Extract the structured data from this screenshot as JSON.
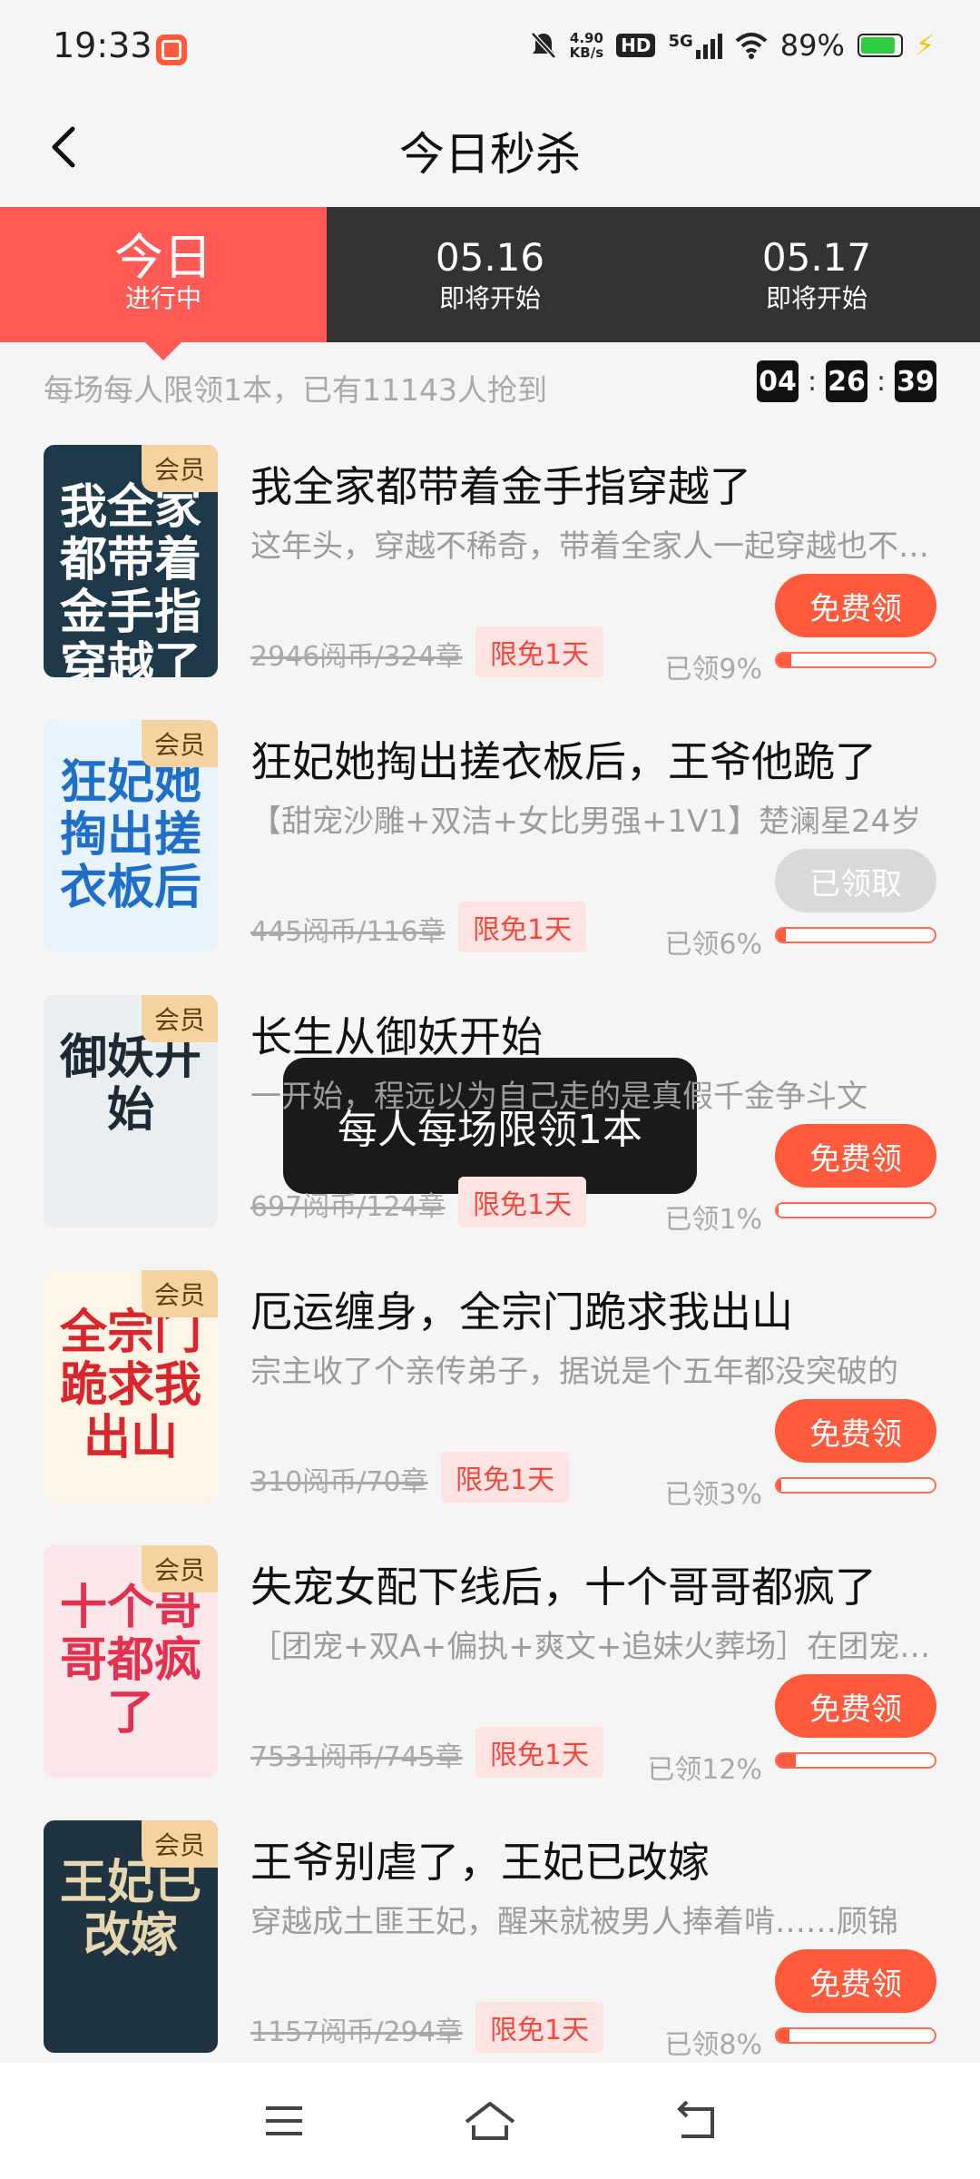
{
  "status_bar": {
    "time": "19:33",
    "net_speed_value": "4.90",
    "net_speed_unit": "KB/s",
    "hd_label": "HD",
    "network": "5G",
    "battery_percent": "89%",
    "battery_level": 0.89
  },
  "header": {
    "title": "今日秒杀",
    "back_icon": "chevron-left-icon"
  },
  "tabs": [
    {
      "top": "今日",
      "bottom": "进行中",
      "active": true
    },
    {
      "top": "05.16",
      "bottom": "即将开始",
      "active": false
    },
    {
      "top": "05.17",
      "bottom": "即将开始",
      "active": false
    }
  ],
  "info": {
    "text": "每场每人限领1本，已有11143人抢到",
    "countdown": {
      "hours": "04",
      "minutes": "26",
      "seconds": "39",
      "separator": ":"
    }
  },
  "vip_label": "会员",
  "books": [
    {
      "title": "我全家都带着金手指穿越了",
      "desc": "这年头，穿越不稀奇，带着全家人一起穿越也不稀奇",
      "price": "2946阅币/324章",
      "free_tag": "限免1天",
      "button": "免费领",
      "claimed": false,
      "claimed_text": "已领9%",
      "progress": 0.09,
      "cover_text": "我全家都带着金手指穿越了",
      "cover_bg": "#1e3a4a",
      "cover_fg": "#ffffff"
    },
    {
      "title": "狂妃她掏出搓衣板后，王爷他跪了",
      "desc": "【甜宠沙雕+双洁+女比男强+1V1】楚澜星24岁",
      "price": "445阅币/116章",
      "free_tag": "限免1天",
      "button": "已领取",
      "claimed": true,
      "claimed_text": "已领6%",
      "progress": 0.06,
      "cover_text": "狂妃她掏出搓衣板后",
      "cover_bg": "#e8f3fb",
      "cover_fg": "#1f6fc9"
    },
    {
      "title": "长生从御妖开始",
      "desc": "一开始，程远以为自己走的是真假千金争斗文",
      "price": "697阅币/124章",
      "free_tag": "限免1天",
      "button": "免费领",
      "claimed": false,
      "claimed_text": "已领1%",
      "progress": 0.01,
      "cover_text": "御妖开始",
      "cover_bg": "#e9eef0",
      "cover_fg": "#1d2a33"
    },
    {
      "title": "厄运缠身，全宗门跪求我出山",
      "desc": "宗主收了个亲传弟子，据说是个五年都没突破的",
      "price": "310阅币/70章",
      "free_tag": "限免1天",
      "button": "免费领",
      "claimed": false,
      "claimed_text": "已领3%",
      "progress": 0.03,
      "cover_text": "全宗门跪求我出山",
      "cover_bg": "#fdf6e6",
      "cover_fg": "#d8262c"
    },
    {
      "title": "失宠女配下线后，十个哥哥都疯了",
      "desc": "［团宠+双A+偏执+爽文+追妹火葬场］在团宠文里",
      "price": "7531阅币/745章",
      "free_tag": "限免1天",
      "button": "免费领",
      "claimed": false,
      "claimed_text": "已领12%",
      "progress": 0.12,
      "cover_text": "十个哥哥都疯了",
      "cover_bg": "#fbe6ea",
      "cover_fg": "#e2314f"
    },
    {
      "title": "王爷别虐了，王妃已改嫁",
      "desc": "穿越成土匪王妃，醒来就被男人捧着啃……顾锦",
      "price": "1157阅币/294章",
      "free_tag": "限免1天",
      "button": "免费领",
      "claimed": false,
      "claimed_text": "已领8%",
      "progress": 0.08,
      "cover_text": "王妃已改嫁",
      "cover_bg": "#1f3340",
      "cover_fg": "#e7d7b0"
    }
  ],
  "toast": "每人每场限领1本",
  "navbar": {
    "menu_icon": "menu-icon",
    "home_icon": "home-icon",
    "back_icon": "back-icon"
  },
  "colors": {
    "accent": "#ff5a3c",
    "active_tab": "#ff5a55",
    "tab_bar": "#333333",
    "vip_tag": "#f5d3a1"
  }
}
